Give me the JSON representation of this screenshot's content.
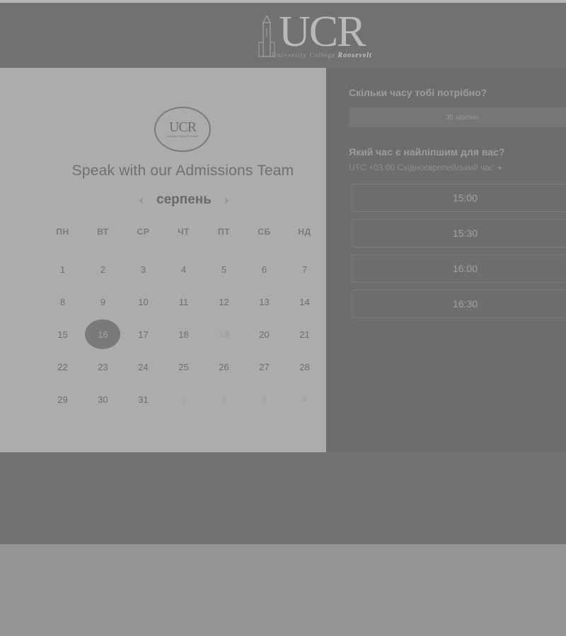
{
  "header": {
    "logo_text": "UCR",
    "logo_subtitle": "University College",
    "logo_script": "Roosevelt"
  },
  "left": {
    "emblem_text": "UCR",
    "emblem_subtitle": "University College Roosevelt",
    "title": "Speak with our Admissions Team",
    "month": "серпень",
    "prev_icon": "‹",
    "next_icon": "›",
    "weekdays": [
      "ПН",
      "ВТ",
      "СР",
      "ЧТ",
      "ПТ",
      "СБ",
      "НД"
    ],
    "weeks": [
      [
        "1",
        "2",
        "3",
        "4",
        "5",
        "6",
        "7"
      ],
      [
        "8",
        "9",
        "10",
        "11",
        "12",
        "13",
        "14"
      ],
      [
        "15",
        "16",
        "17",
        "18",
        "19",
        "20",
        "21"
      ],
      [
        "22",
        "23",
        "24",
        "25",
        "26",
        "27",
        "28"
      ],
      [
        "29",
        "30",
        "31",
        "1",
        "2",
        "3",
        "4"
      ]
    ]
  },
  "right": {
    "duration_question": "Скільки часу тобі потрібно?",
    "duration_value": "30 хвилин",
    "time_question": "Який час є найліпшим для вас?",
    "timezone": "UTC +03:00 Східноєвропейський час",
    "slots": [
      "15:00",
      "15:30",
      "16:00",
      "16:30"
    ]
  }
}
